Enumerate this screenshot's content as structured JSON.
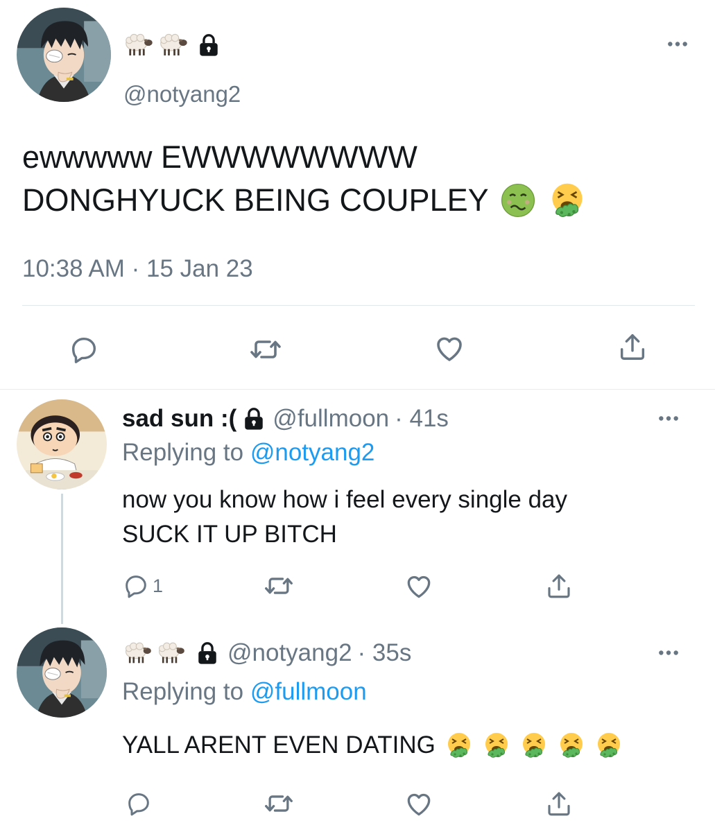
{
  "main_tweet": {
    "display_name_icons": [
      "sheep-icon",
      "sheep-icon",
      "lock-icon"
    ],
    "handle": "@notyang2",
    "text_line1": "ewwwww EWWWWWWWW",
    "text_line2": "DONGHYUCK BEING COUPLEY",
    "emojis": [
      "nauseated-face-icon",
      "vomiting-face-icon"
    ],
    "timestamp": "10:38 AM · 15 Jan 23",
    "actions": [
      "reply-icon",
      "retweet-icon",
      "like-icon",
      "share-icon"
    ]
  },
  "reply1": {
    "display_name": "sad sun :(",
    "handle": "@fullmoon",
    "time": "· 41s",
    "replying_prefix": "Replying to",
    "replying_to": "@notyang2",
    "text_line1": "now you know how i feel every single day",
    "text_line2": "SUCK IT UP BITCH",
    "reply_count": "1"
  },
  "reply2": {
    "display_name_icons": [
      "sheep-icon",
      "sheep-icon",
      "lock-icon"
    ],
    "handle": "@notyang2",
    "time": "· 35s",
    "replying_prefix": "Replying to",
    "replying_to": "@fullmoon",
    "text": "YALL ARENT EVEN DATING",
    "emoji_count": 5
  },
  "colors": {
    "text": "#14171a",
    "secondary": "#687684",
    "link": "#1d9bf0",
    "divider": "#e1e8ed"
  }
}
